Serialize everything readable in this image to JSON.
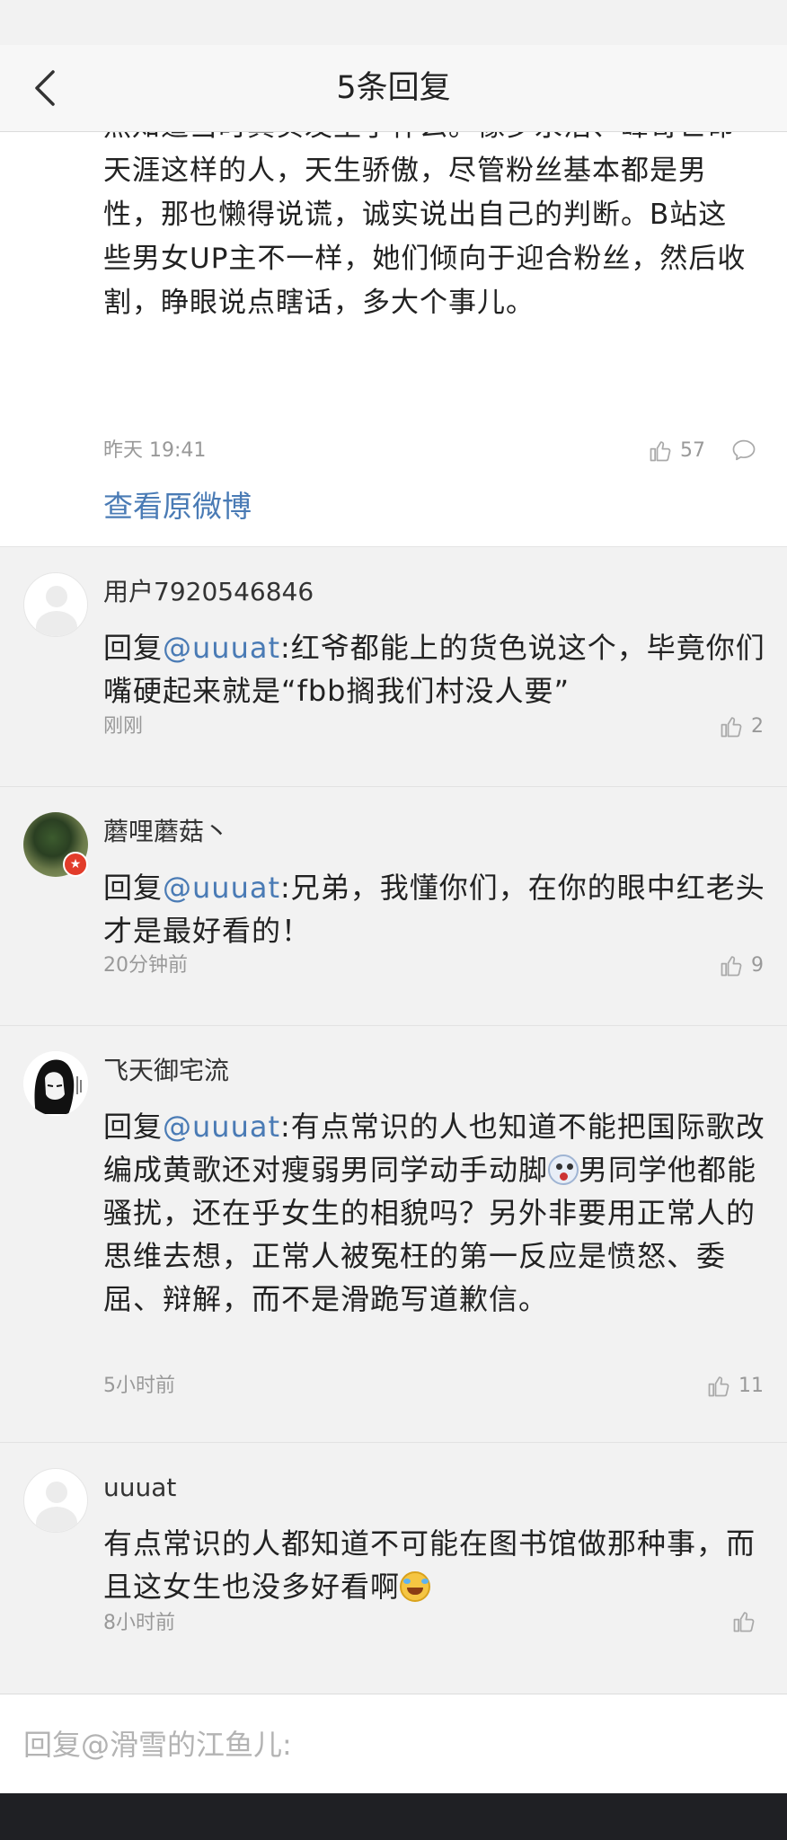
{
  "nav": {
    "title": "5条回复"
  },
  "original": {
    "text": "然知道当时真实发生了什么。像罗永浩、峰哥亡命天涯这样的人，天生骄傲，尽管粉丝基本都是男性，那也懒得说谎，诚实说出自己的判断。B站这些男女UP主不一样，她们倾向于迎合粉丝，然后收割，睁眼说点瞎话，多大个事儿。",
    "time": "昨天 19:41",
    "likes": "57",
    "view_original_label": "查看原微博"
  },
  "replies": [
    {
      "name": "用户7920546846",
      "prefix": "回复",
      "mention": "@uuuat",
      "text": ":红爷都能上的货色说这个，毕竟你们嘴硬起来就是“fbb搁我们村没人要”",
      "time": "刚刚",
      "likes": "2"
    },
    {
      "name": "蘑哩蘑菇丶",
      "prefix": "回复",
      "mention": "@uuuat",
      "text": ":兄弟，我懂你们，在你的眼中红老头才是最好看的！",
      "time": "20分钟前",
      "likes": "9"
    },
    {
      "name": "飞天御宅流",
      "prefix": "回复",
      "mention": "@uuuat",
      "text_a": ":有点常识的人也知道不能把国际歌改编成黄歌还对瘦弱男同学动手动脚",
      "text_b": "男同学他都能骚扰，还在乎女生的相貌吗？另外非要用正常人的思维去想，正常人被冤枉的第一反应是愤怒、委屈、辩解，而不是滑跪写道歉信。",
      "time": "5小时前",
      "likes": "11"
    },
    {
      "name": "uuuat",
      "text": "有点常识的人都知道不可能在图书馆做那种事，而且这女生也没多好看啊",
      "time": "8小时前",
      "likes": ""
    }
  ],
  "input": {
    "placeholder": "回复@滑雪的江鱼儿:"
  },
  "icons": {
    "back": "chevron-left-icon",
    "like": "thumbs-up-icon",
    "comment": "comment-bubble-icon",
    "emoji_1": "shocked-face-emoji",
    "emoji_2": "laugh-cry-emoji"
  },
  "colors": {
    "link": "#4a7bb5",
    "badge": "#e23c2a"
  }
}
